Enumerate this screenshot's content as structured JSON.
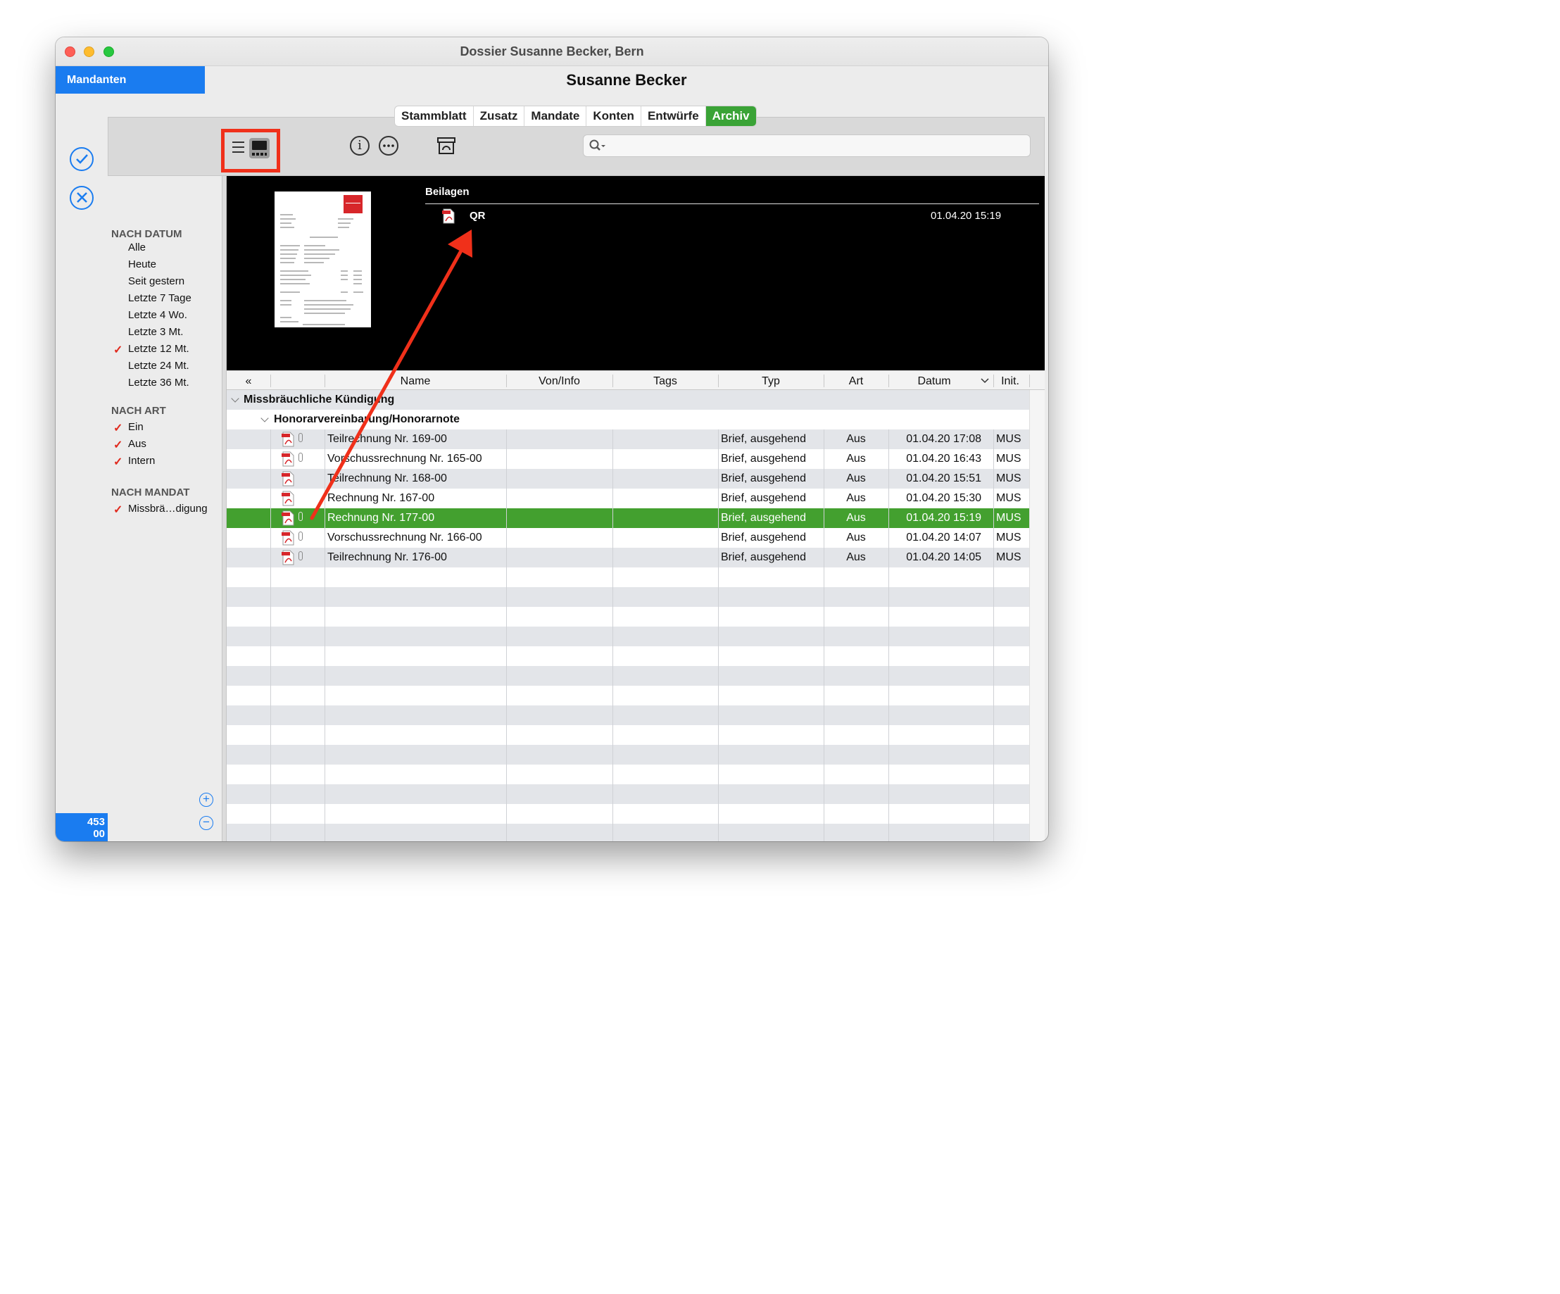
{
  "window": {
    "title": "Dossier Susanne Becker, Bern"
  },
  "mandanten_button": "Mandanten",
  "page_title": "Susanne Becker",
  "tabs": [
    {
      "label": "Stammblatt",
      "active": false
    },
    {
      "label": "Zusatz",
      "active": false
    },
    {
      "label": "Mandate",
      "active": false
    },
    {
      "label": "Konten",
      "active": false
    },
    {
      "label": "Entwürfe",
      "active": false
    },
    {
      "label": "Archiv",
      "active": true
    }
  ],
  "toolbar": {
    "icons": [
      "list-view-icon",
      "gallery-view-icon",
      "info-icon",
      "more-icon",
      "archive-box-icon",
      "search-icon"
    ],
    "search_value": ""
  },
  "left_strip": {
    "confirm_icon": "checkmark-circle-icon",
    "cancel_icon": "x-circle-icon",
    "count_line1": "453",
    "count_line2": "00"
  },
  "sidebar": {
    "nach_datum": {
      "heading": "NACH DATUM",
      "items": [
        {
          "label": "Alle",
          "checked": false
        },
        {
          "label": "Heute",
          "checked": false
        },
        {
          "label": "Seit gestern",
          "checked": false
        },
        {
          "label": "Letzte 7 Tage",
          "checked": false
        },
        {
          "label": "Letzte 4 Wo.",
          "checked": false
        },
        {
          "label": "Letzte 3 Mt.",
          "checked": false
        },
        {
          "label": "Letzte 12 Mt.",
          "checked": true
        },
        {
          "label": "Letzte 24 Mt.",
          "checked": false
        },
        {
          "label": "Letzte 36 Mt.",
          "checked": false
        }
      ]
    },
    "nach_art": {
      "heading": "NACH ART",
      "items": [
        {
          "label": "Ein",
          "checked": true
        },
        {
          "label": "Aus",
          "checked": true
        },
        {
          "label": "Intern",
          "checked": true
        }
      ]
    },
    "nach_mandat": {
      "heading": "NACH MANDAT",
      "items": [
        {
          "label": "Missbrä…digung",
          "checked": true
        }
      ]
    },
    "check_glyph": "✓",
    "plus": "+",
    "minus": "−"
  },
  "preview": {
    "beilagen_heading": "Beilagen",
    "attachment": {
      "name": "QR",
      "date": "01.04.20 15:19",
      "icon": "pdf-icon"
    }
  },
  "table": {
    "columns": {
      "collapse": "«",
      "name": "Name",
      "von_info": "Von/Info",
      "tags": "Tags",
      "typ": "Typ",
      "art": "Art",
      "datum": "Datum",
      "init": "Init."
    },
    "group1": "Missbräuchliche Kündigung",
    "group2": "Honorarvereinbarung/Honorarnote",
    "rows": [
      {
        "name": "Teilrechnung Nr. 169-00",
        "von_info": "",
        "tags": "",
        "typ": "Brief, ausgehend",
        "art": "Aus",
        "datum": "01.04.20 17:08",
        "init": "MUS",
        "attachment": true,
        "selected": false
      },
      {
        "name": "Vorschussrechnung Nr. 165-00",
        "von_info": "",
        "tags": "",
        "typ": "Brief, ausgehend",
        "art": "Aus",
        "datum": "01.04.20 16:43",
        "init": "MUS",
        "attachment": true,
        "selected": false
      },
      {
        "name": "Teilrechnung Nr. 168-00",
        "von_info": "",
        "tags": "",
        "typ": "Brief, ausgehend",
        "art": "Aus",
        "datum": "01.04.20 15:51",
        "init": "MUS",
        "attachment": false,
        "selected": false
      },
      {
        "name": "Rechnung Nr. 167-00",
        "von_info": "",
        "tags": "",
        "typ": "Brief, ausgehend",
        "art": "Aus",
        "datum": "01.04.20 15:30",
        "init": "MUS",
        "attachment": false,
        "selected": false
      },
      {
        "name": "Rechnung Nr. 177-00",
        "von_info": "",
        "tags": "",
        "typ": "Brief, ausgehend",
        "art": "Aus",
        "datum": "01.04.20 15:19",
        "init": "MUS",
        "attachment": true,
        "selected": true
      },
      {
        "name": "Vorschussrechnung Nr. 166-00",
        "von_info": "",
        "tags": "",
        "typ": "Brief, ausgehend",
        "art": "Aus",
        "datum": "01.04.20 14:07",
        "init": "MUS",
        "attachment": true,
        "selected": false
      },
      {
        "name": "Teilrechnung Nr. 176-00",
        "von_info": "",
        "tags": "",
        "typ": "Brief, ausgehend",
        "art": "Aus",
        "datum": "01.04.20 14:05",
        "init": "MUS",
        "attachment": true,
        "selected": false
      }
    ]
  },
  "colors": {
    "accent_blue": "#1a7cf0",
    "active_tab_green": "#3aa336",
    "selected_row_green": "#43a02f",
    "highlight_red": "#f0301a"
  }
}
